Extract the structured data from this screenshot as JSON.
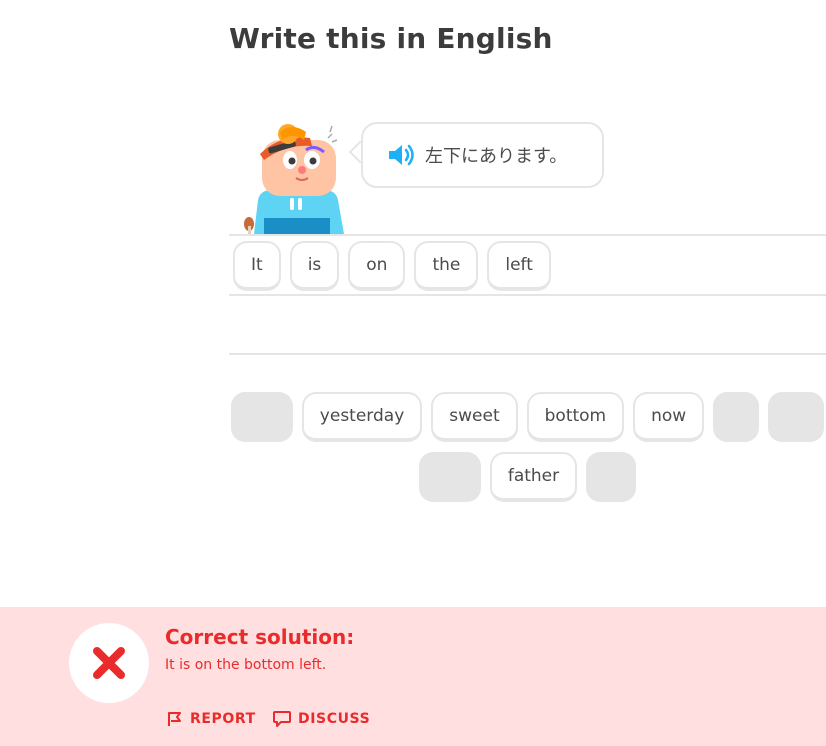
{
  "header": {
    "title": "Write this in English"
  },
  "prompt": {
    "text": "左下にあります。",
    "speaker_icon": "speaker-icon"
  },
  "answer": {
    "words": [
      "It",
      "is",
      "on",
      "the",
      "left"
    ]
  },
  "word_bank": {
    "row1": [
      {
        "type": "slot"
      },
      {
        "type": "word",
        "label": "yesterday"
      },
      {
        "type": "word",
        "label": "sweet"
      },
      {
        "type": "word",
        "label": "bottom"
      },
      {
        "type": "word",
        "label": "now"
      },
      {
        "type": "slot"
      },
      {
        "type": "slot"
      }
    ],
    "row2": [
      {
        "type": "slot"
      },
      {
        "type": "word",
        "label": "father"
      },
      {
        "type": "slot"
      }
    ]
  },
  "feedback": {
    "title": "Correct solution:",
    "solution": "It is on the bottom left.",
    "report_label": "REPORT",
    "discuss_label": "DISCUSS",
    "status_icon": "x-icon"
  },
  "colors": {
    "feedback_bg": "#ffdfe0",
    "error_red": "#ea2b2b",
    "speaker_blue": "#1cb0f6",
    "chip_border": "#e5e5e5"
  }
}
